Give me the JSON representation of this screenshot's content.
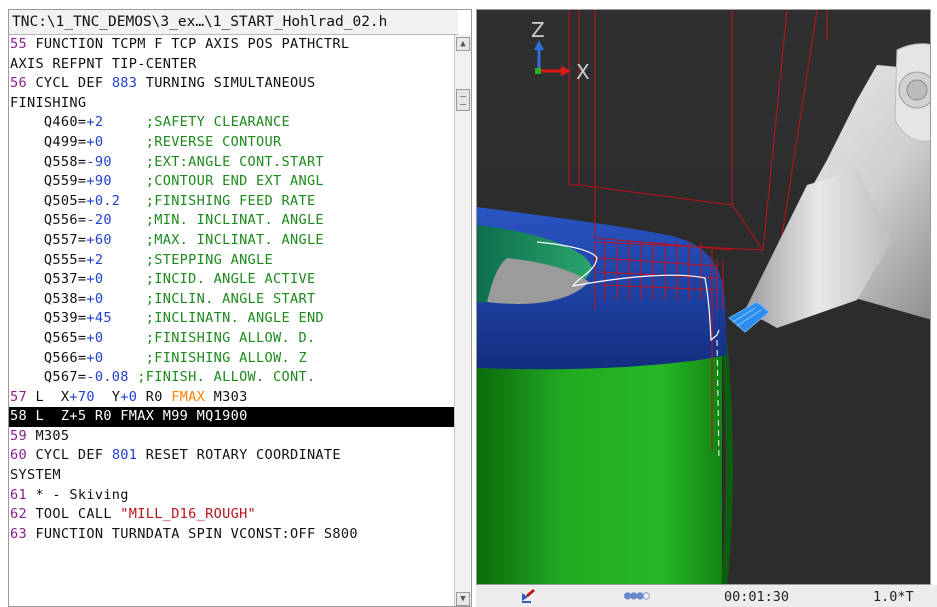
{
  "editor": {
    "path": "TNC:\\1_TNC_DEMOS\\3_ex…\\1_START_Hohlrad_02.h",
    "lines": [
      {
        "n": "55",
        "parts": [
          {
            "t": " FUNCTION TCPM F TCP AXIS POS PATHCTRL"
          }
        ]
      },
      {
        "n": "",
        "parts": [
          {
            "t": "AXIS REFPNT TIP-CENTER"
          }
        ]
      },
      {
        "n": "56",
        "parts": [
          {
            "t": " CYCL DEF "
          },
          {
            "t": "883",
            "c": "num"
          },
          {
            "t": " TURNING SIMULTANEOUS"
          }
        ]
      },
      {
        "n": "",
        "parts": [
          {
            "t": "FINISHING"
          }
        ]
      },
      {
        "n": "",
        "parts": [
          {
            "t": "    Q460="
          },
          {
            "t": "+2     ",
            "c": "num"
          },
          {
            "t": ";SAFETY CLEARANCE",
            "c": "cmt"
          }
        ]
      },
      {
        "n": "",
        "parts": [
          {
            "t": "    Q499="
          },
          {
            "t": "+0     ",
            "c": "num"
          },
          {
            "t": ";REVERSE CONTOUR",
            "c": "cmt"
          }
        ]
      },
      {
        "n": "",
        "parts": [
          {
            "t": "    Q558="
          },
          {
            "t": "-90    ",
            "c": "num"
          },
          {
            "t": ";EXT:ANGLE CONT.START",
            "c": "cmt"
          }
        ]
      },
      {
        "n": "",
        "parts": [
          {
            "t": "    Q559="
          },
          {
            "t": "+90    ",
            "c": "num"
          },
          {
            "t": ";CONTOUR END EXT ANGL",
            "c": "cmt"
          }
        ]
      },
      {
        "n": "",
        "parts": [
          {
            "t": "    Q505="
          },
          {
            "t": "+0.2   ",
            "c": "num"
          },
          {
            "t": ";FINISHING FEED RATE",
            "c": "cmt"
          }
        ]
      },
      {
        "n": "",
        "parts": [
          {
            "t": "    Q556="
          },
          {
            "t": "-20    ",
            "c": "num"
          },
          {
            "t": ";MIN. INCLINAT. ANGLE",
            "c": "cmt"
          }
        ]
      },
      {
        "n": "",
        "parts": [
          {
            "t": "    Q557="
          },
          {
            "t": "+60    ",
            "c": "num"
          },
          {
            "t": ";MAX. INCLINAT. ANGLE",
            "c": "cmt"
          }
        ]
      },
      {
        "n": "",
        "parts": [
          {
            "t": "    Q555="
          },
          {
            "t": "+2     ",
            "c": "num"
          },
          {
            "t": ";STEPPING ANGLE",
            "c": "cmt"
          }
        ]
      },
      {
        "n": "",
        "parts": [
          {
            "t": "    Q537="
          },
          {
            "t": "+0     ",
            "c": "num"
          },
          {
            "t": ";INCID. ANGLE ACTIVE",
            "c": "cmt"
          }
        ]
      },
      {
        "n": "",
        "parts": [
          {
            "t": "    Q538="
          },
          {
            "t": "+0     ",
            "c": "num"
          },
          {
            "t": ";INCLIN. ANGLE START",
            "c": "cmt"
          }
        ]
      },
      {
        "n": "",
        "parts": [
          {
            "t": "    Q539="
          },
          {
            "t": "+45    ",
            "c": "num"
          },
          {
            "t": ";INCLINATN. ANGLE END",
            "c": "cmt"
          }
        ]
      },
      {
        "n": "",
        "parts": [
          {
            "t": "    Q565="
          },
          {
            "t": "+0     ",
            "c": "num"
          },
          {
            "t": ";FINISHING ALLOW. D.",
            "c": "cmt"
          }
        ]
      },
      {
        "n": "",
        "parts": [
          {
            "t": "    Q566="
          },
          {
            "t": "+0     ",
            "c": "num"
          },
          {
            "t": ";FINISHING ALLOW. Z",
            "c": "cmt"
          }
        ]
      },
      {
        "n": "",
        "parts": [
          {
            "t": "    Q567="
          },
          {
            "t": "-0.08 ",
            "c": "num"
          },
          {
            "t": ";FINISH. ALLOW. CONT.",
            "c": "cmt"
          }
        ]
      },
      {
        "n": "57",
        "parts": [
          {
            "t": " L  X"
          },
          {
            "t": "+70",
            "c": "num"
          },
          {
            "t": "  Y"
          },
          {
            "t": "+0",
            "c": "num"
          },
          {
            "t": " R0 "
          },
          {
            "t": "FMAX",
            "c": "fmax"
          },
          {
            "t": " M303"
          }
        ]
      },
      {
        "n": "58",
        "selected": true,
        "parts": [
          {
            "t": " L  Z+5 R0 FMAX M99 MQ1900"
          }
        ]
      },
      {
        "n": "59",
        "parts": [
          {
            "t": " M305"
          }
        ]
      },
      {
        "n": "60",
        "parts": [
          {
            "t": " CYCL DEF "
          },
          {
            "t": "801",
            "c": "num"
          },
          {
            "t": " RESET ROTARY COORDINATE"
          }
        ]
      },
      {
        "n": "",
        "parts": [
          {
            "t": "SYSTEM"
          }
        ]
      },
      {
        "n": "61",
        "parts": [
          {
            "t": " * - Skiving"
          }
        ]
      },
      {
        "n": "62",
        "parts": [
          {
            "t": " TOOL CALL "
          },
          {
            "t": "\"MILL_D16_ROUGH\"",
            "c": "str"
          }
        ]
      },
      {
        "n": "63",
        "parts": [
          {
            "t": " FUNCTION TURNDATA SPIN VCONST:OFF S800"
          }
        ]
      }
    ]
  },
  "axes": {
    "z_label": "Z",
    "x_label": "X"
  },
  "status": {
    "dots": "●●●○",
    "time": "00:01:30",
    "speed": "1.0*T"
  },
  "colors": {
    "line_number": "#8a1f8a",
    "number": "#1f3fcf",
    "comment": "#1d8a1d",
    "fmax": "#ff7f00",
    "string": "#b8141c",
    "workpiece_green": "#1fa51f",
    "workpiece_blue": "#1d3f9e",
    "toolpath_red": "#c0101a",
    "sim_background": "#2c2c2c"
  }
}
